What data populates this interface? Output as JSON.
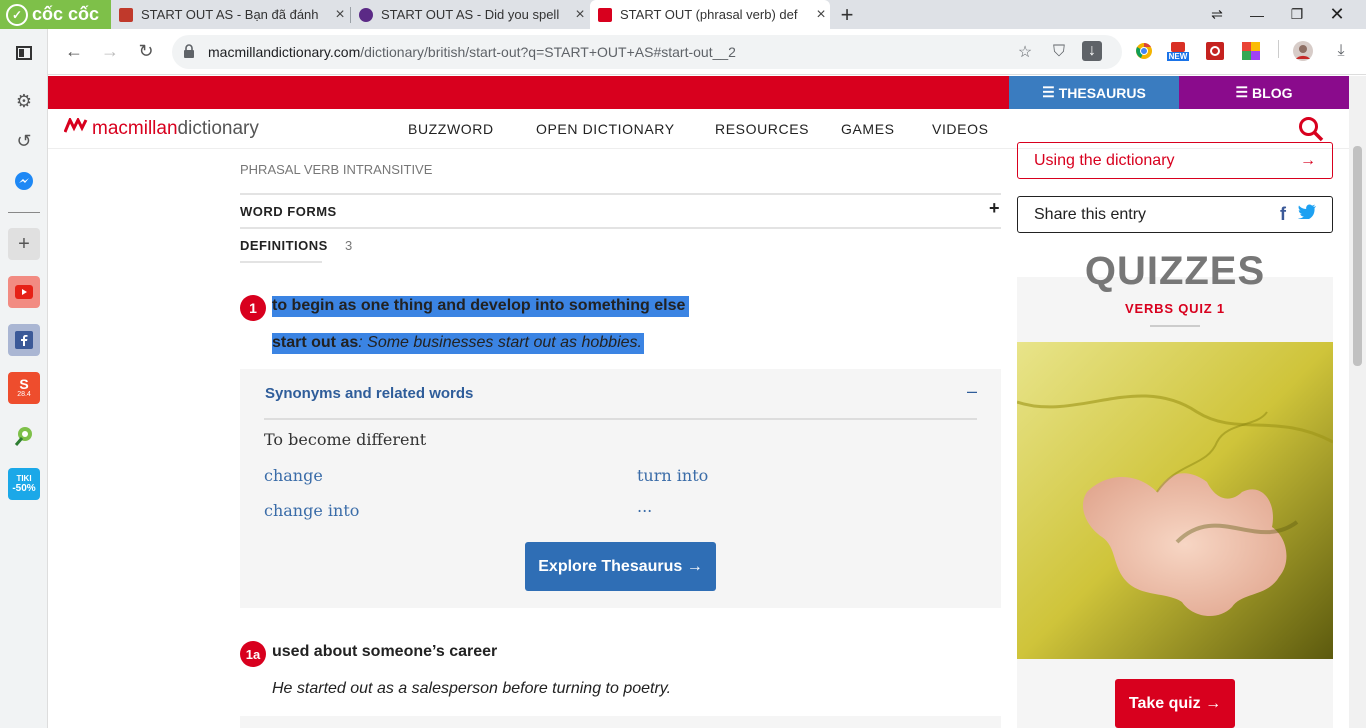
{
  "browser": {
    "logo": "cốc cốc",
    "tabs": [
      {
        "title": "START OUT AS - Bạn đã đánh",
        "favicon_color": "#c0392b"
      },
      {
        "title": "START OUT AS - Did you spell",
        "favicon_color": "#5b2a86"
      },
      {
        "title": "START OUT (phrasal verb) def",
        "favicon_color": "#d8001e"
      }
    ],
    "url_host": "macmillandictionary.com",
    "url_path": "/dictionary/british/start-out?q=START+OUT+AS#start-out__2",
    "new_badge": "NEW"
  },
  "sidebar": {
    "icons": [
      "panel-icon",
      "gear-icon",
      "history-icon",
      "messenger-icon",
      "add-icon",
      "youtube-icon",
      "facebook-icon",
      "shopee-icon",
      "leaf-icon",
      "tiki-icon"
    ],
    "shopee_badge": "28.4",
    "tiki_label": "TIKI",
    "tiki_discount": "-50%"
  },
  "site": {
    "thesaurus": "THESAURUS",
    "blog": "BLOG",
    "brand_mac": "macmillan",
    "brand_dict": " dictionary",
    "nav": [
      "BUZZWORD",
      "OPEN DICTIONARY",
      "RESOURCES",
      "GAMES",
      "VIDEOS"
    ]
  },
  "entry": {
    "pos": "PHRASAL VERB INTRANSITIVE",
    "word_forms": "WORD FORMS",
    "definitions_label": "DEFINITIONS",
    "definitions_count": "3",
    "def1": {
      "num": "1",
      "text": "to begin as one thing and develop into something else",
      "example_bold": "start out as",
      "example_text": ": Some businesses start out as hobbies."
    },
    "synonyms": {
      "heading": "Synonyms and related words",
      "subheading": "To become different",
      "words": [
        "change",
        "turn into",
        "change into",
        "..."
      ],
      "explore": "Explore Thesaurus →"
    },
    "def1a": {
      "num": "1a",
      "text": "used about someone’s career",
      "example": "He started out as a salesperson before turning to poetry."
    }
  },
  "right": {
    "using": "Using the dictionary",
    "share": "Share this entry",
    "quizzes": "QUIZZES",
    "quiz_name": "VERBS QUIZ 1",
    "take_quiz": "Take quiz →"
  }
}
